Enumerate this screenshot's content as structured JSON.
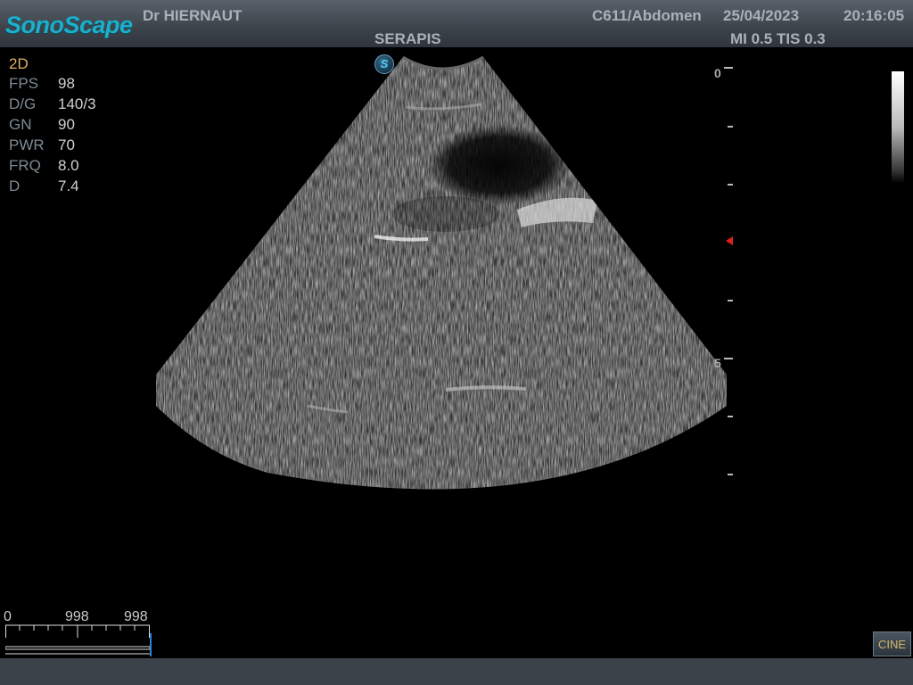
{
  "header": {
    "brand": "SonoScape",
    "doctor": "Dr HIERNAUT",
    "probe_preset": "C611/Abdomen",
    "date": "25/04/2023",
    "time": "20:16:05",
    "hospital": "SERAPIS",
    "mi_tis": "MI 0.5 TIS 0.3"
  },
  "mode": "2D",
  "params": [
    {
      "label": "FPS",
      "value": "98"
    },
    {
      "label": "D/G",
      "value": "140/3"
    },
    {
      "label": "GN",
      "value": "90"
    },
    {
      "label": "PWR",
      "value": "70"
    },
    {
      "label": "FRQ",
      "value": "8.0"
    },
    {
      "label": "D",
      "value": "7.4"
    }
  ],
  "probe_orientation_mark": "S",
  "depth_scale": {
    "label_top": "0",
    "label_mid": "5"
  },
  "cine": {
    "start": "0",
    "current": "998",
    "total": "998",
    "button_label": "CINE"
  },
  "colors": {
    "brand": "#1ab0cc",
    "mode": "#e0b060",
    "focus_marker": "#e02020",
    "cine_cursor": "#2d7fd8"
  }
}
